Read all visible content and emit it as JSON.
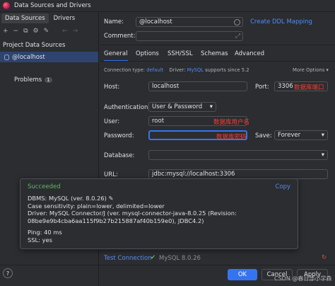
{
  "window": {
    "title": "Data Sources and Drivers"
  },
  "left": {
    "tabs": [
      "Data Sources",
      "Drivers"
    ],
    "section": "Project Data Sources",
    "item": "@localhost",
    "problems_label": "Problems",
    "problems_count": "1"
  },
  "main": {
    "name_label": "Name:",
    "name_value": "@localhost",
    "create_ddl": "Create DDL Mapping",
    "comment_label": "Comment:",
    "tabs": [
      "General",
      "Options",
      "SSH/SSL",
      "Schemas",
      "Advanced"
    ],
    "conn_type_label": "Connection type:",
    "conn_type_value": "default",
    "driver_label": "Driver:",
    "driver_value": "MySQL",
    "driver_note": "supports since 5.2",
    "more_options": "More Options",
    "host_label": "Host:",
    "host_value": "localhost",
    "port_label": "Port:",
    "port_value": "3306",
    "port_note": "数据库端口",
    "auth_label": "Authentication:",
    "auth_value": "User & Password",
    "user_label": "User:",
    "user_value": "root",
    "user_note": "数据库用户名",
    "password_label": "Password:",
    "password_note": "数据库密码",
    "save_label": "Save:",
    "save_value": "Forever",
    "database_label": "Database:",
    "url_label": "URL:",
    "url_value": "jdbc:mysql://localhost:3306",
    "test_connection": "Test Connection",
    "test_version": "MySQL 8.0.26"
  },
  "popup": {
    "status": "Succeeded",
    "copy": "Copy",
    "lines": [
      "DBMS: MySQL (ver. 8.0.26)",
      "Case sensitivity: plain=lower, delimited=lower",
      "Driver: MySQL Connector/J (ver. mysql-connector-java-8.0.25 (Revision:",
      "08be9e9b4cba6aa115f9b27b215887af40b159e0), JDBC4.2)",
      "",
      "Ping: 40 ms",
      "SSL: yes"
    ]
  },
  "buttons": {
    "ok": "OK",
    "cancel": "Cancel",
    "apply": "Apply"
  },
  "help": "?",
  "watermark": "CSDN @春日部小学森",
  "colors": {
    "accent": "#3574f0",
    "success": "#5fb865",
    "annotation": "#ff3b30"
  }
}
